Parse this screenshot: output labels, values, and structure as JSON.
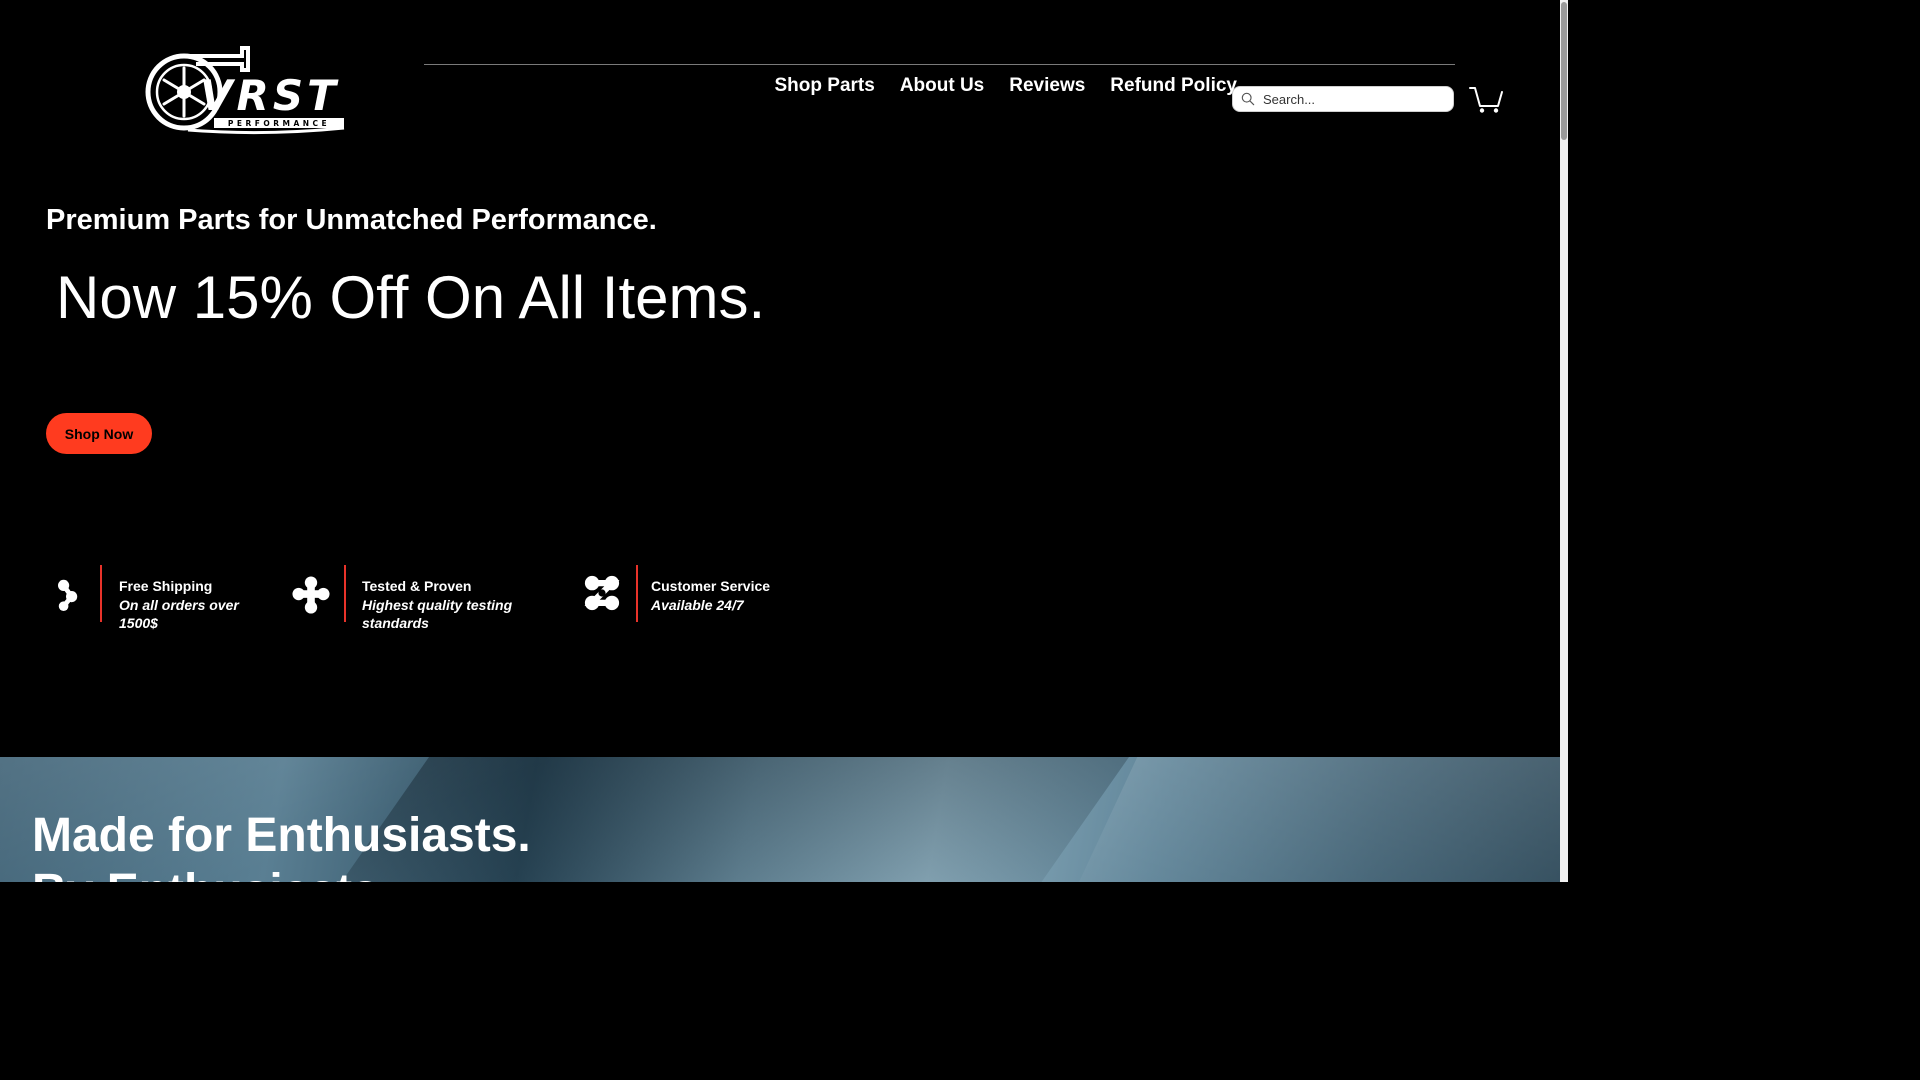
{
  "header": {
    "nav": [
      {
        "label": "Shop Parts"
      },
      {
        "label": "About Us"
      },
      {
        "label": "Reviews"
      },
      {
        "label": "Refund Policy"
      }
    ],
    "search": {
      "placeholder": "Search..."
    },
    "logo": {
      "text": "VRST",
      "subtext": "PERFORMANCE"
    }
  },
  "hero": {
    "tagline": "Premium Parts for Unmatched Performance.",
    "promo": "Now 15% Off On All Items.",
    "cta_label": "Shop Now",
    "cta_color": "#ff3b1f"
  },
  "features": [
    {
      "title": "Free Shipping",
      "subtitle": "On all orders over 1500$",
      "icon": "shipping-icon"
    },
    {
      "title": "Tested & Proven",
      "subtitle": "Highest quality testing standards",
      "icon": "quality-icon"
    },
    {
      "title": "Customer Service",
      "subtitle": "Available 24/7",
      "icon": "support-icon"
    }
  ],
  "banner": {
    "line1": "Made for Enthusiasts.",
    "line2": "By Enthusiasts."
  },
  "colors": {
    "accent": "#ff3b1f",
    "divider": "#e8332a",
    "background": "#000000"
  }
}
